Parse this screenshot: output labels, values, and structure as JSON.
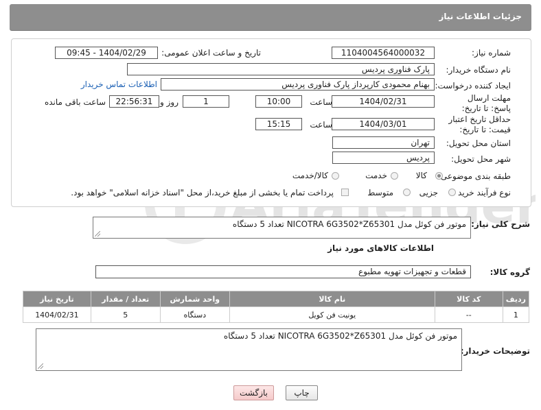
{
  "header": {
    "title": "جزئیات اطلاعات نیاز"
  },
  "form": {
    "need_number_label": "شماره نیاز:",
    "need_number": "1104004564000032",
    "announce_label": "تاریخ و ساعت اعلان عمومی:",
    "announce_value": "1404/02/29 - 09:45",
    "buyer_org_label": "نام دستگاه خریدار:",
    "buyer_org": "پارک فناوری پردیس",
    "creator_label": "ایجاد کننده درخواست:",
    "creator": "بهنام محمودی کارپرداز پارک فناوری پردیس",
    "contact_link": "اطلاعات تماس خریدار",
    "deadline_label": "مهلت ارسال پاسخ: تا تاریخ:",
    "deadline_date": "1404/02/31",
    "time_label": "ساعت",
    "deadline_time": "10:00",
    "days_value": "1",
    "days_label": "روز و",
    "remaining_time": "22:56:31",
    "remaining_label": "ساعت باقی مانده",
    "validity_label": "حداقل تاریخ اعتبار قیمت: تا تاریخ:",
    "validity_date": "1404/03/01",
    "validity_time_label": "ساعت",
    "validity_time": "15:15",
    "province_label": "استان محل تحویل:",
    "province": "تهران",
    "city_label": "شهر محل تحویل:",
    "city": "پردیس",
    "category_label": "طبقه بندی موضوعی:",
    "category_options": [
      "کالا",
      "خدمت",
      "کالا/خدمت"
    ],
    "process_label": "نوع فرآیند خرید :",
    "process_options": [
      "جزیی",
      "متوسط"
    ],
    "payment_note": "پرداخت تمام یا بخشی از مبلغ خرید،از محل \"اسناد خزانه اسلامی\" خواهد بود."
  },
  "summary": {
    "label": "شرح کلی نیاز:",
    "text": "موتور فن کوئل مدل  NICOTRA 6G3502*Z65301 تعداد 5 دستگاه"
  },
  "goods": {
    "section_title": "اطلاعات کالاهای مورد نیاز",
    "group_label": "گروه کالا:",
    "group_value": "قطعات و تجهیزات تهویه مطبوع",
    "columns": [
      "ردیف",
      "کد کالا",
      "نام کالا",
      "واحد شمارش",
      "تعداد / مقدار",
      "تاریخ نیاز"
    ],
    "rows": [
      [
        "1",
        "--",
        "یونیت فن کویل",
        "دستگاه",
        "5",
        "1404/02/31"
      ]
    ]
  },
  "buyer_notes": {
    "label": "توضیحات خریدار:",
    "text": "موتور فن کوئل مدل  NICOTRA 6G3502*Z65301 تعداد 5 دستگاه"
  },
  "buttons": {
    "print": "چاپ",
    "back": "بازگشت"
  },
  "watermark": {
    "text": "AriaTender.neT"
  }
}
